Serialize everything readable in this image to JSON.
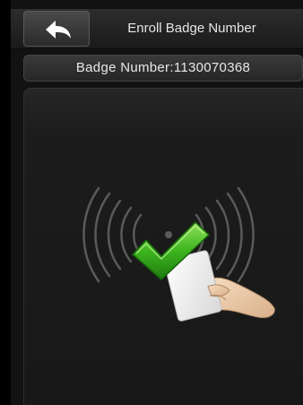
{
  "header": {
    "title": "Enroll Badge Number",
    "back_icon": "back-arrow-icon"
  },
  "badge": {
    "label": "Badge Number:1130070368"
  },
  "illustration": {
    "icons": [
      "rfid-signal-icon",
      "checkmark-icon",
      "card-in-hand-icon"
    ],
    "colors": {
      "check": "#3db51e",
      "waves": "#5a5a5a"
    }
  }
}
